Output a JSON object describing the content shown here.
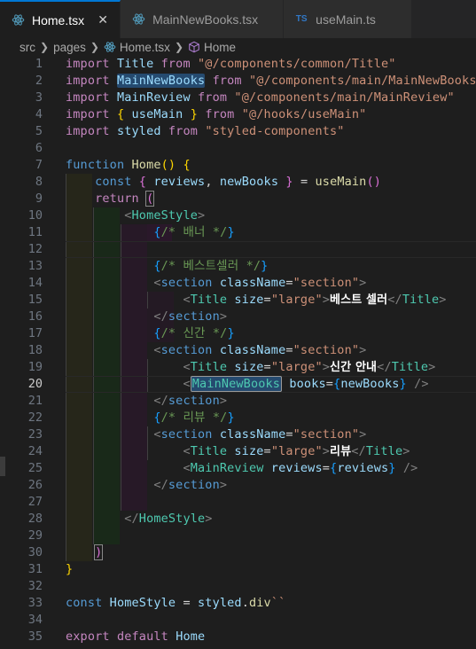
{
  "tabs": [
    {
      "label": "Home.tsx",
      "active": true,
      "icon": "react-icon",
      "close": "✕"
    },
    {
      "label": "MainNewBooks.tsx",
      "active": false,
      "icon": "react-icon"
    },
    {
      "label": "useMain.ts",
      "active": false,
      "icon": "ts-icon",
      "icon_text": "TS"
    }
  ],
  "breadcrumb": {
    "items": [
      "src",
      "pages",
      "Home.tsx",
      "Home"
    ]
  },
  "colors": {
    "keyword": "#c586c0",
    "storage": "#569cd6",
    "variable": "#9cdcfe",
    "function": "#dcdcaa",
    "string": "#ce9178",
    "comment": "#6a9955",
    "component": "#4ec9b0",
    "active_tab_border": "#0078d4"
  },
  "editor": {
    "current_line": 20,
    "lines": [
      {
        "n": "1"
      },
      {
        "n": "2"
      },
      {
        "n": "3"
      },
      {
        "n": "4"
      },
      {
        "n": "5"
      },
      {
        "n": "6"
      },
      {
        "n": "7"
      },
      {
        "n": "8"
      },
      {
        "n": "9"
      },
      {
        "n": "10"
      },
      {
        "n": "11"
      },
      {
        "n": "12"
      },
      {
        "n": "13"
      },
      {
        "n": "14"
      },
      {
        "n": "15"
      },
      {
        "n": "16"
      },
      {
        "n": "17"
      },
      {
        "n": "18"
      },
      {
        "n": "19"
      },
      {
        "n": "20"
      },
      {
        "n": "21"
      },
      {
        "n": "22"
      },
      {
        "n": "23"
      },
      {
        "n": "24"
      },
      {
        "n": "25"
      },
      {
        "n": "26"
      },
      {
        "n": "27"
      },
      {
        "n": "28"
      },
      {
        "n": "29"
      },
      {
        "n": "30"
      },
      {
        "n": "31"
      },
      {
        "n": "32"
      },
      {
        "n": "33"
      },
      {
        "n": "34"
      },
      {
        "n": "35"
      }
    ],
    "tokens": {
      "import": "import",
      "from": "from",
      "Title": "Title",
      "MainNewBooks": "MainNewBooks",
      "MainReview": "MainReview",
      "useMain": "useMain",
      "styled": "styled",
      "path_title": "\"@/components/common/Title\"",
      "path_mainnewbooks": "\"@/components/main/MainNewBooks\"",
      "path_mainreview": "\"@/components/main/MainReview\"",
      "path_usemain": "\"@/hooks/useMain\"",
      "path_styled": "\"styled-components\"",
      "function": "function",
      "Home": "Home",
      "const": "const",
      "reviews": "reviews",
      "newBooks": "newBooks",
      "return": "return",
      "HomeStyle": "HomeStyle",
      "c_banner": "/* 배너 */",
      "c_best": "/* 베스트셀러 */",
      "c_new": "/* 신간 */",
      "c_review": "/* 리뷰 */",
      "section": "section",
      "className": "className",
      "str_section": "\"section\"",
      "size": "size",
      "str_large": "\"large\"",
      "txt_best": "베스트 셀러",
      "txt_new": "신간 안내",
      "txt_review": "리뷰",
      "books": "books",
      "reviews_attr": "reviews",
      "div": "div",
      "export": "export",
      "default": "default"
    }
  }
}
